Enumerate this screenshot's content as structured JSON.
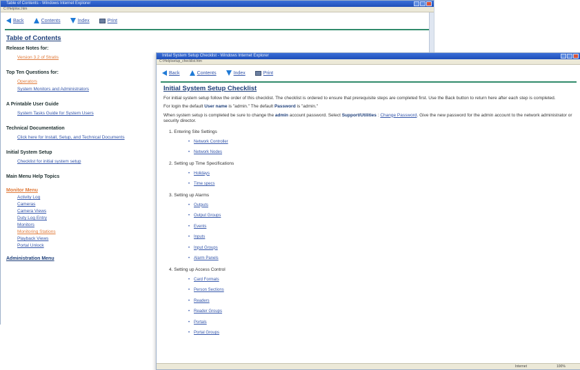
{
  "back_window": {
    "title": "Table of Contents - Windows Internet Explorer",
    "address": "C:\\Help\\toc.htm",
    "toolbar": {
      "back": "Back",
      "contents": "Contents",
      "index": "Index",
      "print": "Print"
    },
    "toc_title": "Table of Contents",
    "sections": [
      {
        "heading": "Release Notes for:",
        "links": [
          {
            "label": "Version 3.2 of Stratis",
            "style": "orange"
          }
        ]
      },
      {
        "heading": "Top Ten Questions for:",
        "links": [
          {
            "label": "Operators",
            "style": "orange"
          },
          {
            "label": "System Monitors and Administrators",
            "style": "blue"
          }
        ]
      },
      {
        "heading": "A Printable User Guide",
        "links": [
          {
            "label": "System Tasks Guide for System Users",
            "style": "blue"
          }
        ]
      },
      {
        "heading": "Technical Documentation",
        "links": [
          {
            "label": "Click here for Install, Setup, and Technical Documents",
            "style": "blue"
          }
        ]
      },
      {
        "heading": "Initial System Setup",
        "links": [
          {
            "label": "Checklist for initial system setup",
            "style": "blue"
          }
        ]
      },
      {
        "heading": "Main Menu Help Topics",
        "links": []
      }
    ],
    "monitor_menu": {
      "heading": "Monitor Menu",
      "items": [
        {
          "label": "Activity Log",
          "style": "blue"
        },
        {
          "label": "Cameras",
          "style": "blue"
        },
        {
          "label": "Camera Views",
          "style": "blue"
        },
        {
          "label": "Duty Log Entry",
          "style": "blue"
        },
        {
          "label": "Monitors",
          "style": "blue"
        },
        {
          "label": "Monitoring Stations",
          "style": "orange"
        },
        {
          "label": "Playback Views",
          "style": "blue"
        },
        {
          "label": "Portal Unlock",
          "style": "blue"
        }
      ]
    },
    "admin_menu": "Administration Menu"
  },
  "front_window": {
    "title": "Initial System Setup Checklist - Windows Internet Explorer",
    "address": "C:\\Help\\setup_checklist.htm",
    "toolbar": {
      "back": "Back",
      "contents": "Contents",
      "index": "Index",
      "print": "Print"
    },
    "page_title": "Initial System Setup Checklist",
    "para1": "For initial system setup follow the order of this checklist. The checklist is ordered to ensure that prerequisite steps are completed first. Use the Back button to return here after each step is completed.",
    "para2_pre": "For login the default ",
    "para2_user_label": "User name",
    "para2_mid": " is \"admin.\" The default ",
    "para2_pass_label": "Password",
    "para2_post": " is \"admin.\"",
    "para3_pre": "When system setup is completed be sure to change the ",
    "para3_admin": "admin",
    "para3_mid": " account password. Select ",
    "para3_menu": "Support/Utilities",
    "para3_sep": " : ",
    "para3_link": "Change Password",
    "para3_post": ". Give the new password for the admin account to the network administrator or security director.",
    "steps": [
      {
        "label": "1.  Entering Site Settings",
        "items": [
          "Network Controller",
          "Network Nodes"
        ]
      },
      {
        "label": "2.  Setting up Time Specifications",
        "items": [
          "Holidays",
          "Time specs"
        ]
      },
      {
        "label": "3.  Setting up Alarms",
        "items": [
          "Outputs",
          "Output Groups",
          "Events",
          "Inputs",
          "Input Groups",
          "Alarm Panels"
        ]
      },
      {
        "label": "4.  Setting up Access Control",
        "items": [
          "Card Formats",
          "Person Sections",
          "Readers",
          "Reader Groups",
          "Portals",
          "Portal Groups"
        ]
      }
    ],
    "status": {
      "zone": "Internet",
      "zoom": "100%"
    }
  }
}
